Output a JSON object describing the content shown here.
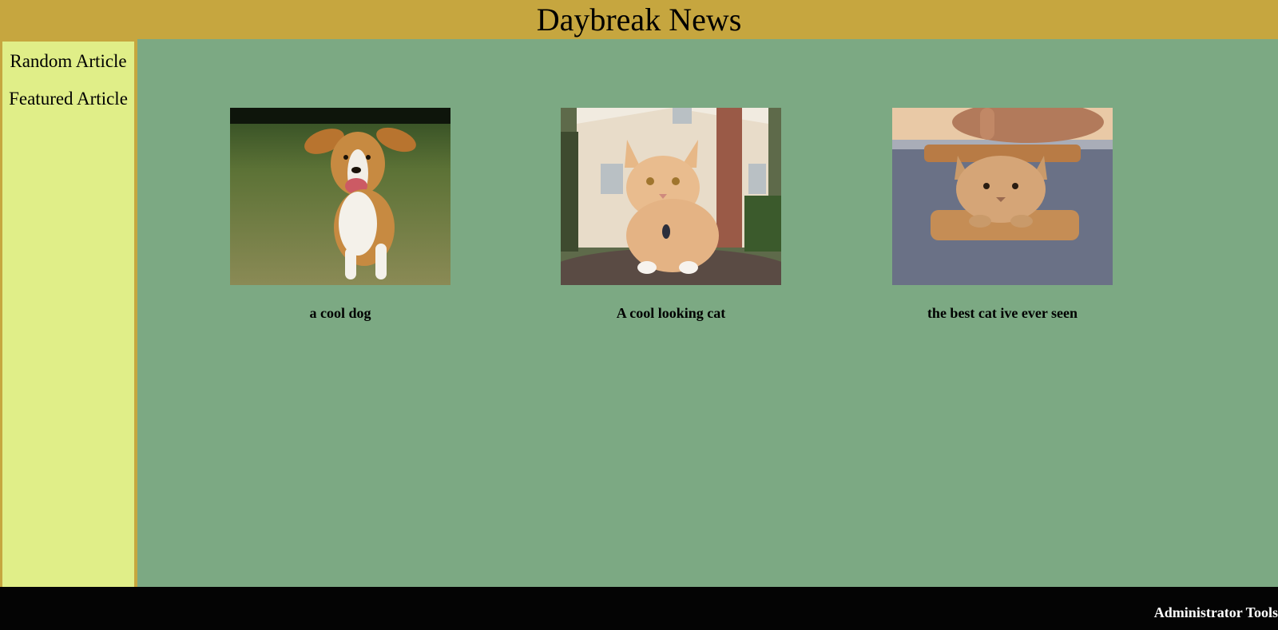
{
  "header": {
    "title": "Daybreak News"
  },
  "sidebar": {
    "items": [
      {
        "label": "Random Article"
      },
      {
        "label": "Featured Article"
      }
    ]
  },
  "articles": [
    {
      "caption": "a cool dog",
      "image": "dog-running-photo"
    },
    {
      "caption": "A cool looking cat",
      "image": "orange-cat-photo"
    },
    {
      "caption": "the best cat ive ever seen",
      "image": "cat-in-bread-photo"
    }
  ],
  "footer": {
    "admin_label": "Administrator Tools"
  },
  "colors": {
    "header_bg": "#c6a63f",
    "sidebar_bg": "#e0ee88",
    "main_bg": "#7ca983",
    "footer_bg": "#040404"
  }
}
